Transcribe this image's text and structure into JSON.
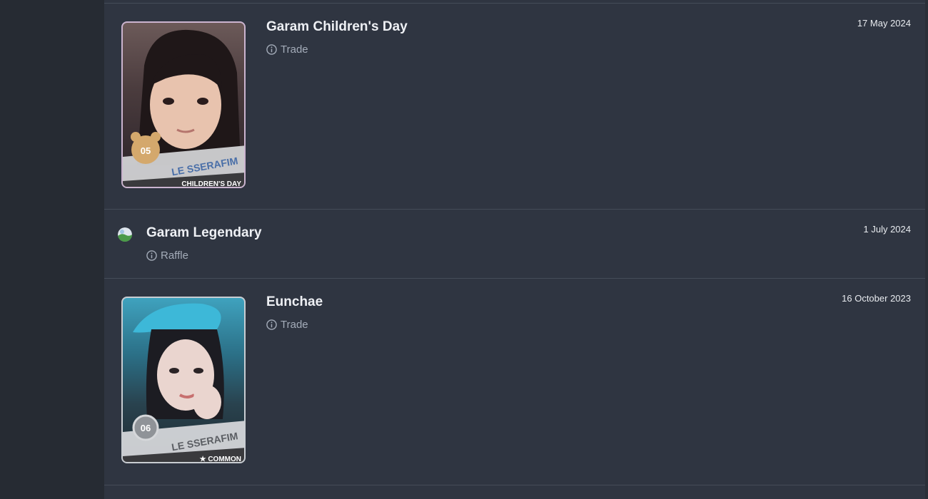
{
  "entries": [
    {
      "title": "Garam Children's Day",
      "meta_label": "Trade",
      "date": "17 May 2024",
      "card": {
        "number": "05",
        "group": "LE SSERAFIM",
        "footer": "CHILDREN'S DAY"
      }
    },
    {
      "title": "Garam Legendary",
      "meta_label": "Raffle",
      "date": "1 July 2024"
    },
    {
      "title": "Eunchae",
      "meta_label": "Trade",
      "date": "16 October 2023",
      "card": {
        "number": "06",
        "group": "LE SSERAFIM",
        "footer": "★ COMMON"
      }
    }
  ],
  "icons": {
    "meta": "info-icon",
    "legendary": "avatar-icon"
  }
}
